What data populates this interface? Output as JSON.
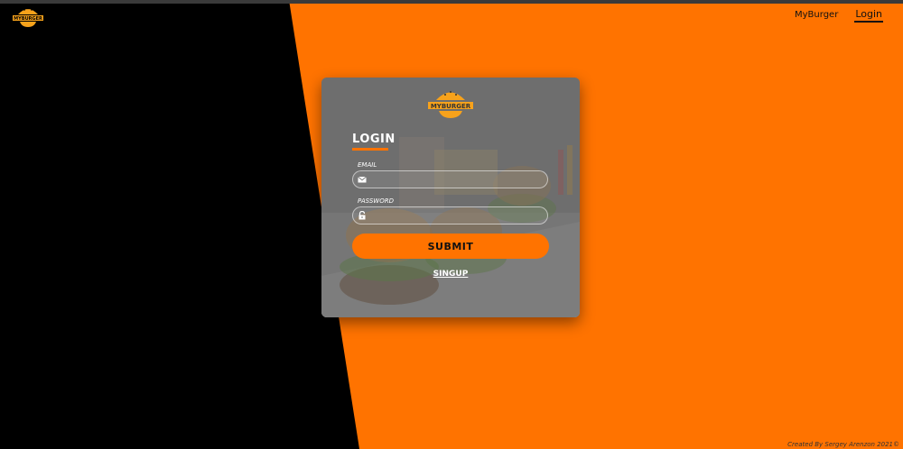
{
  "brand": {
    "logo_text": "MYBURGER",
    "logo_icon": "burger-logo"
  },
  "nav": {
    "items": [
      {
        "label": "MyBurger",
        "active": false
      },
      {
        "label": "Login",
        "active": true
      }
    ]
  },
  "login_card": {
    "logo_text": "MYBURGER",
    "title": "LOGIN",
    "email_label": "EMAIL",
    "email_icon": "envelope-icon",
    "email_value": "",
    "password_label": "PASSWORD",
    "password_icon": "lock-icon",
    "password_value": "",
    "submit_label": "SUBMIT",
    "signup_label": "SINGUP"
  },
  "footer": {
    "text": "Created By Sergey Arenzon 2021©"
  },
  "colors": {
    "accent": "#ff7300",
    "dark": "#000000",
    "logo_yellow": "#f7a21b"
  }
}
